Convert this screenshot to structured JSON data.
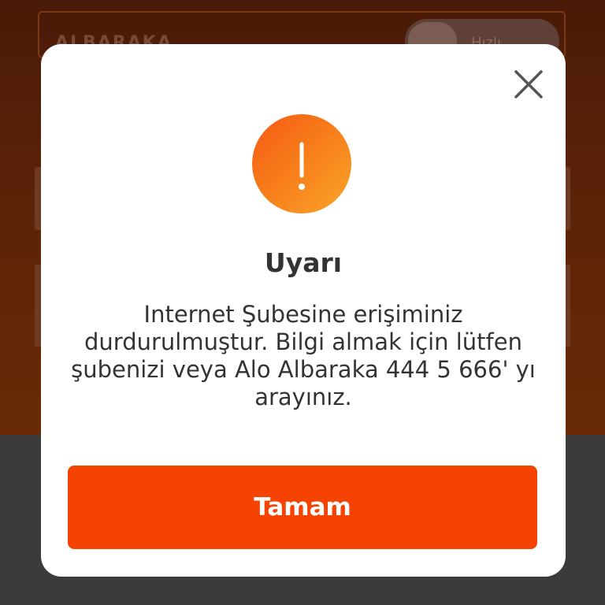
{
  "background": {
    "header_logo_text": "ΑLBΑRΑΚΑ",
    "header_toggle_label": "Hızlı"
  },
  "dialog": {
    "title": "Uyarı",
    "message": "Internet Şubesine erişiminiz durdurulmuştur. Bilgi almak için lütfen şubenizi veya Alo Albaraka 444 5 666' yı arayınız.",
    "ok_label": "Tamam",
    "icons": {
      "close": "close-icon",
      "alert": "exclamation-icon"
    }
  },
  "colors": {
    "accent": "#f54304",
    "icon_gradient_start": "#f55a14",
    "icon_gradient_end": "#fba52a",
    "text": "#333333",
    "overlay_bottom": "#3b3b3b"
  }
}
